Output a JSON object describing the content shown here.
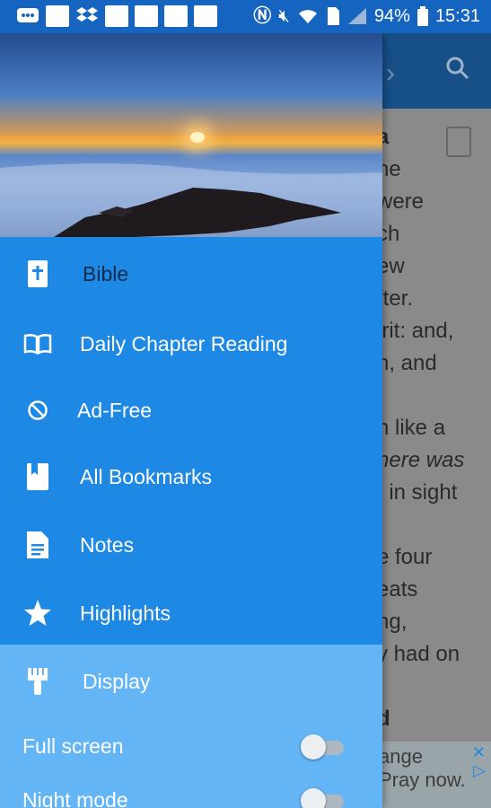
{
  "status_bar": {
    "battery": "94%",
    "time": "15:31"
  },
  "reader": {
    "lines": [
      "a",
      "he",
      "were",
      "ch",
      "ew",
      "fter.",
      "irit: and,",
      "n, and",
      "n like a",
      "here was",
      ", in sight",
      "e four",
      "eats",
      "ng,",
      "y had on",
      "d"
    ]
  },
  "ad": {
    "line1": "ange",
    "line2": "Pray now."
  },
  "drawer": {
    "items": [
      {
        "label": "Bible",
        "icon": "bible-icon"
      },
      {
        "label": "Daily Chapter Reading",
        "icon": "open-book-icon"
      },
      {
        "label": "Ad-Free",
        "icon": "block-icon"
      },
      {
        "label": "All Bookmarks",
        "icon": "bookmark-icon"
      },
      {
        "label": "Notes",
        "icon": "note-icon"
      },
      {
        "label": "Highlights",
        "icon": "star-icon"
      }
    ],
    "display": {
      "label": "Display",
      "icon": "brush-icon"
    },
    "toggles": [
      {
        "label": "Full screen",
        "on": false
      },
      {
        "label": "Night mode",
        "on": false
      }
    ]
  }
}
